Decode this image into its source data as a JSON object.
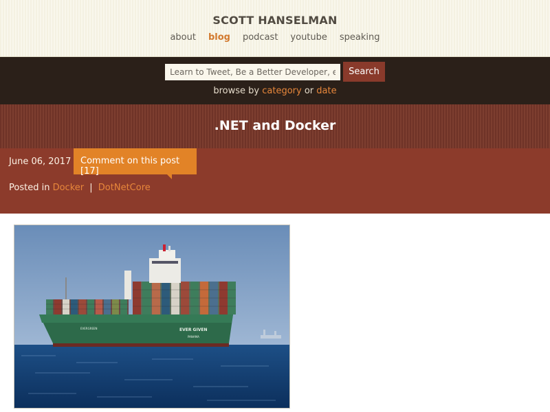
{
  "site": {
    "title": "SCOTT HANSELMAN",
    "nav": [
      {
        "label": "about",
        "active": false
      },
      {
        "label": "blog",
        "active": true
      },
      {
        "label": "podcast",
        "active": false
      },
      {
        "label": "youtube",
        "active": false
      },
      {
        "label": "speaking",
        "active": false
      }
    ]
  },
  "search": {
    "placeholder": "Learn to Tweet, Be a Better Developer, e",
    "button_label": "Search",
    "browse_prefix": "browse by",
    "browse_category": "category",
    "browse_or": "or",
    "browse_date": "date"
  },
  "post": {
    "title": ".NET and Docker",
    "date": "June 06, 2017",
    "comment_label": "Comment on this post [17]",
    "posted_in_label": "Posted in",
    "categories": [
      "Docker",
      "DotNetCore"
    ],
    "category_separator": "|",
    "image_alt": "container ship at sea",
    "ship_name": "EVER GIVEN",
    "ship_port": "PANAMA",
    "ship_bow_text": "EVERGREEN"
  },
  "colors": {
    "accent_orange": "#e28327",
    "link_orange": "#e8873b",
    "dark_band": "#2b2019",
    "rust_band": "#8c3b2b",
    "search_button": "#893a2b"
  }
}
